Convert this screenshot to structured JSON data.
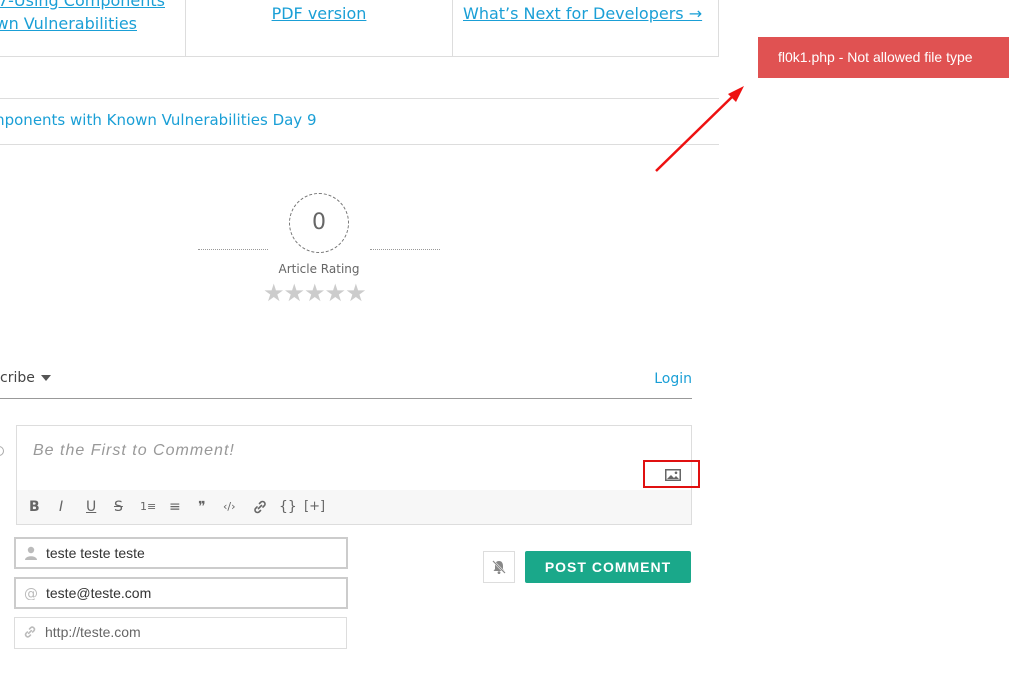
{
  "nav": {
    "prev_line1": "7-Using Components",
    "prev_line2": "wn Vulnerabilities",
    "pdf": "PDF version",
    "next": "What’s Next for Developers →"
  },
  "related": {
    "link": "mponents with Known Vulnerabilities Day 9"
  },
  "toast": {
    "message": "fl0k1.php - Not allowed file type",
    "color": "#e05252"
  },
  "rating": {
    "value": "0",
    "label": "Article Rating",
    "stars_filled": 0,
    "stars_total": 5,
    "star_glyph": "★"
  },
  "comments": {
    "subscribe": "cribe",
    "login": "Login",
    "placeholder": "Be the First to Comment!",
    "toolbar": {
      "bold": "B",
      "italic": "I",
      "underline": "U",
      "strike": "S",
      "ol": "1≡",
      "ul": "≡",
      "quote": "❞",
      "code": "‹/›",
      "link": "link",
      "source": "{}",
      "spoiler": "[+]"
    },
    "name": "teste teste teste",
    "email": "teste@teste.com",
    "website": "http://teste.com",
    "post_button": "POST COMMENT"
  },
  "colors": {
    "link": "#1a9fd6",
    "post_button": "#1aa88a",
    "highlight": "#e01010"
  }
}
